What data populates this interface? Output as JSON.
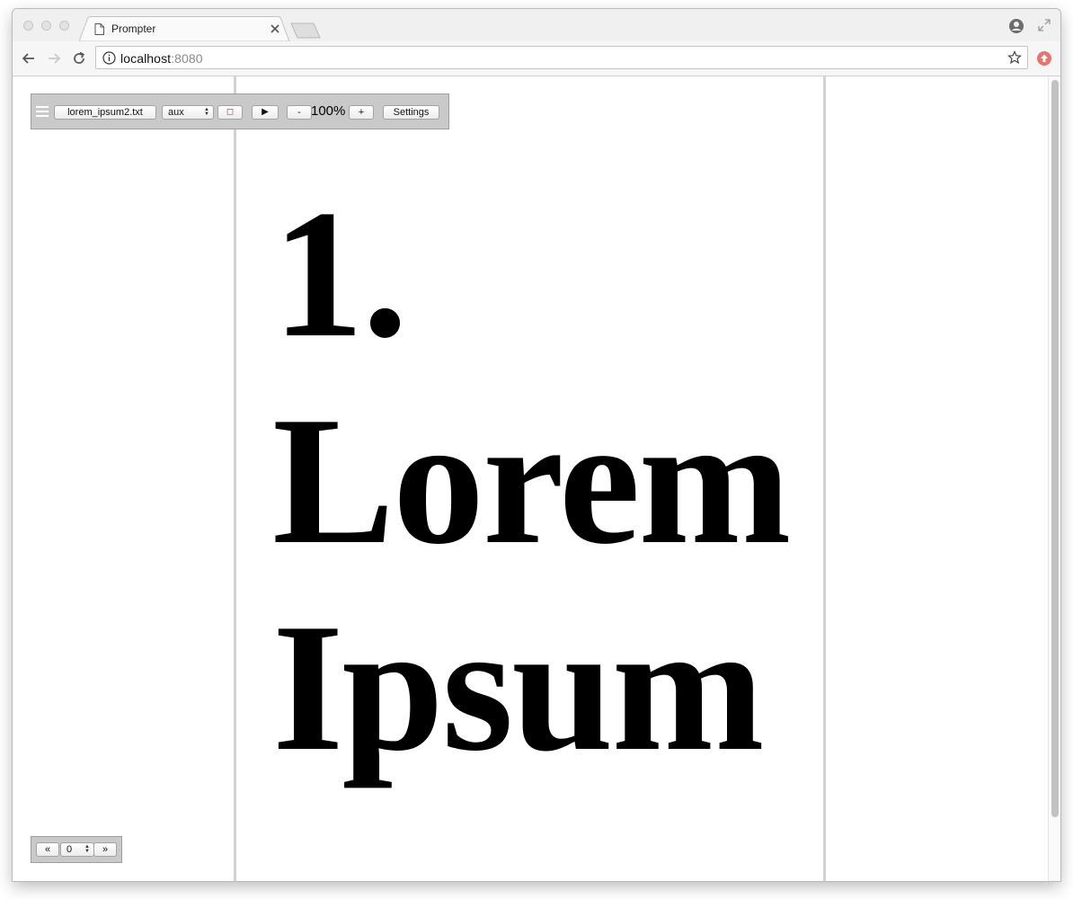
{
  "browser": {
    "tab_title": "Prompter",
    "url_host": "localhost",
    "url_port": ":8080",
    "accent_ext_color": "#e8736f"
  },
  "controls": {
    "file_label": "lorem_ipsum2.txt",
    "mode_select_value": "aux",
    "stop_glyph": "◻",
    "play_glyph": "▶",
    "zoom_out_label": "-",
    "zoom_level": "100%",
    "zoom_in_label": "+",
    "settings_label": "Settings"
  },
  "pager": {
    "prev_label": "«",
    "page_value": "0",
    "next_label": "»"
  },
  "script": {
    "lines": [
      "1.",
      "Lorem",
      "Ipsum"
    ]
  }
}
